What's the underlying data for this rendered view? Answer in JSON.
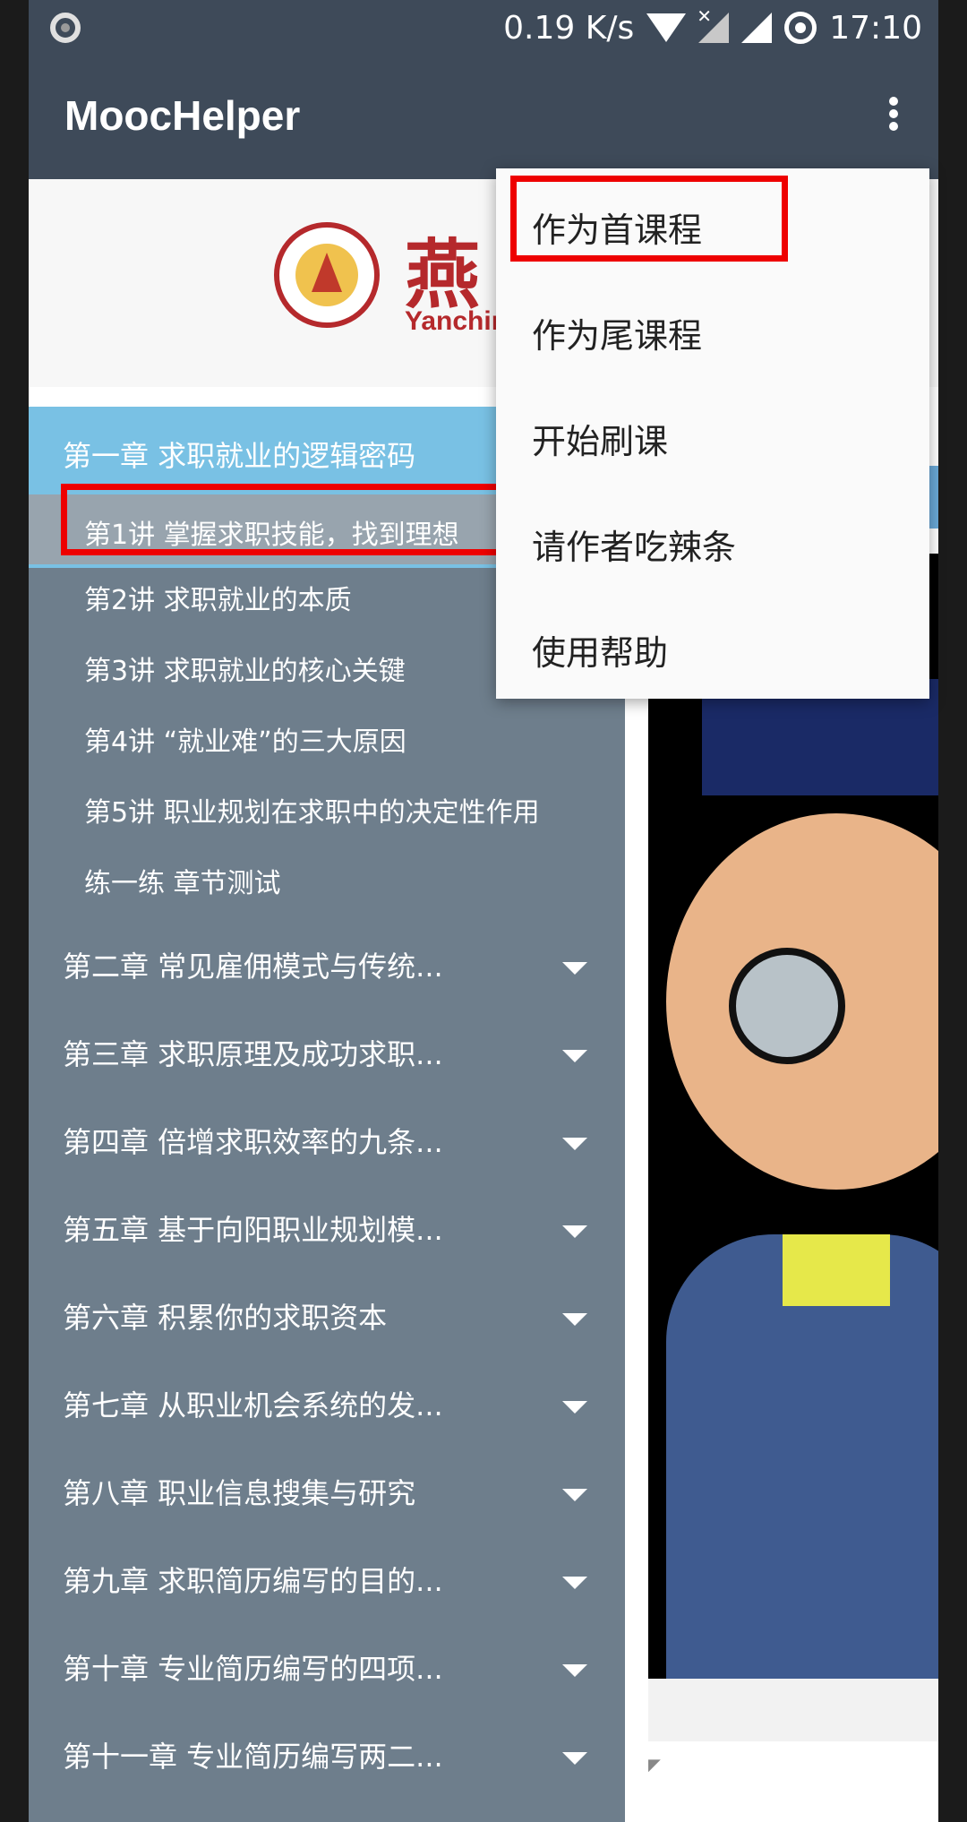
{
  "status_bar": {
    "network_speed": "0.19 K/s",
    "time": "17:10"
  },
  "app_bar": {
    "title": "MoocHelper"
  },
  "logo": {
    "cn_text": "燕",
    "en_text": "Yanching"
  },
  "content_tab": {
    "title_fragment": "",
    "button_fragment": ""
  },
  "overflow_menu": {
    "items": [
      {
        "label": "作为首课程",
        "highlighted": true
      },
      {
        "label": "作为尾课程"
      },
      {
        "label": "开始刷课"
      },
      {
        "label": "请作者吃辣条"
      },
      {
        "label": "使用帮助"
      }
    ]
  },
  "drawer": {
    "open_chapter": {
      "title": "第一章 求职就业的逻辑密码",
      "lessons": [
        {
          "label": "第1讲 掌握求职技能，找到理想",
          "active": true,
          "highlighted": true
        },
        {
          "label": "第2讲 求职就业的本质"
        },
        {
          "label": "第3讲 求职就业的核心关键"
        },
        {
          "label": "第4讲 “就业难”的三大原因"
        },
        {
          "label": "第5讲 职业规划在求职中的决定性作用"
        },
        {
          "label": "练一练 章节测试"
        }
      ]
    },
    "chapters": [
      {
        "title": "第二章 常见雇佣模式与传统..."
      },
      {
        "title": "第三章 求职原理及成功求职..."
      },
      {
        "title": "第四章 倍增求职效率的九条..."
      },
      {
        "title": "第五章 基于向阳职业规划模..."
      },
      {
        "title": "第六章 积累你的求职资本"
      },
      {
        "title": "第七章 从职业机会系统的发..."
      },
      {
        "title": "第八章 职业信息搜集与研究"
      },
      {
        "title": "第九章 求职简历编写的目的..."
      },
      {
        "title": "第十章 专业简历编写的四项..."
      },
      {
        "title": "第十一章 专业简历编写两二..."
      }
    ]
  },
  "colors": {
    "app_bar": "#3e4a59",
    "drawer_bg": "#6e7e8c",
    "open_chapter_bg": "#79c1e4",
    "highlight_box": "#ee0000"
  }
}
